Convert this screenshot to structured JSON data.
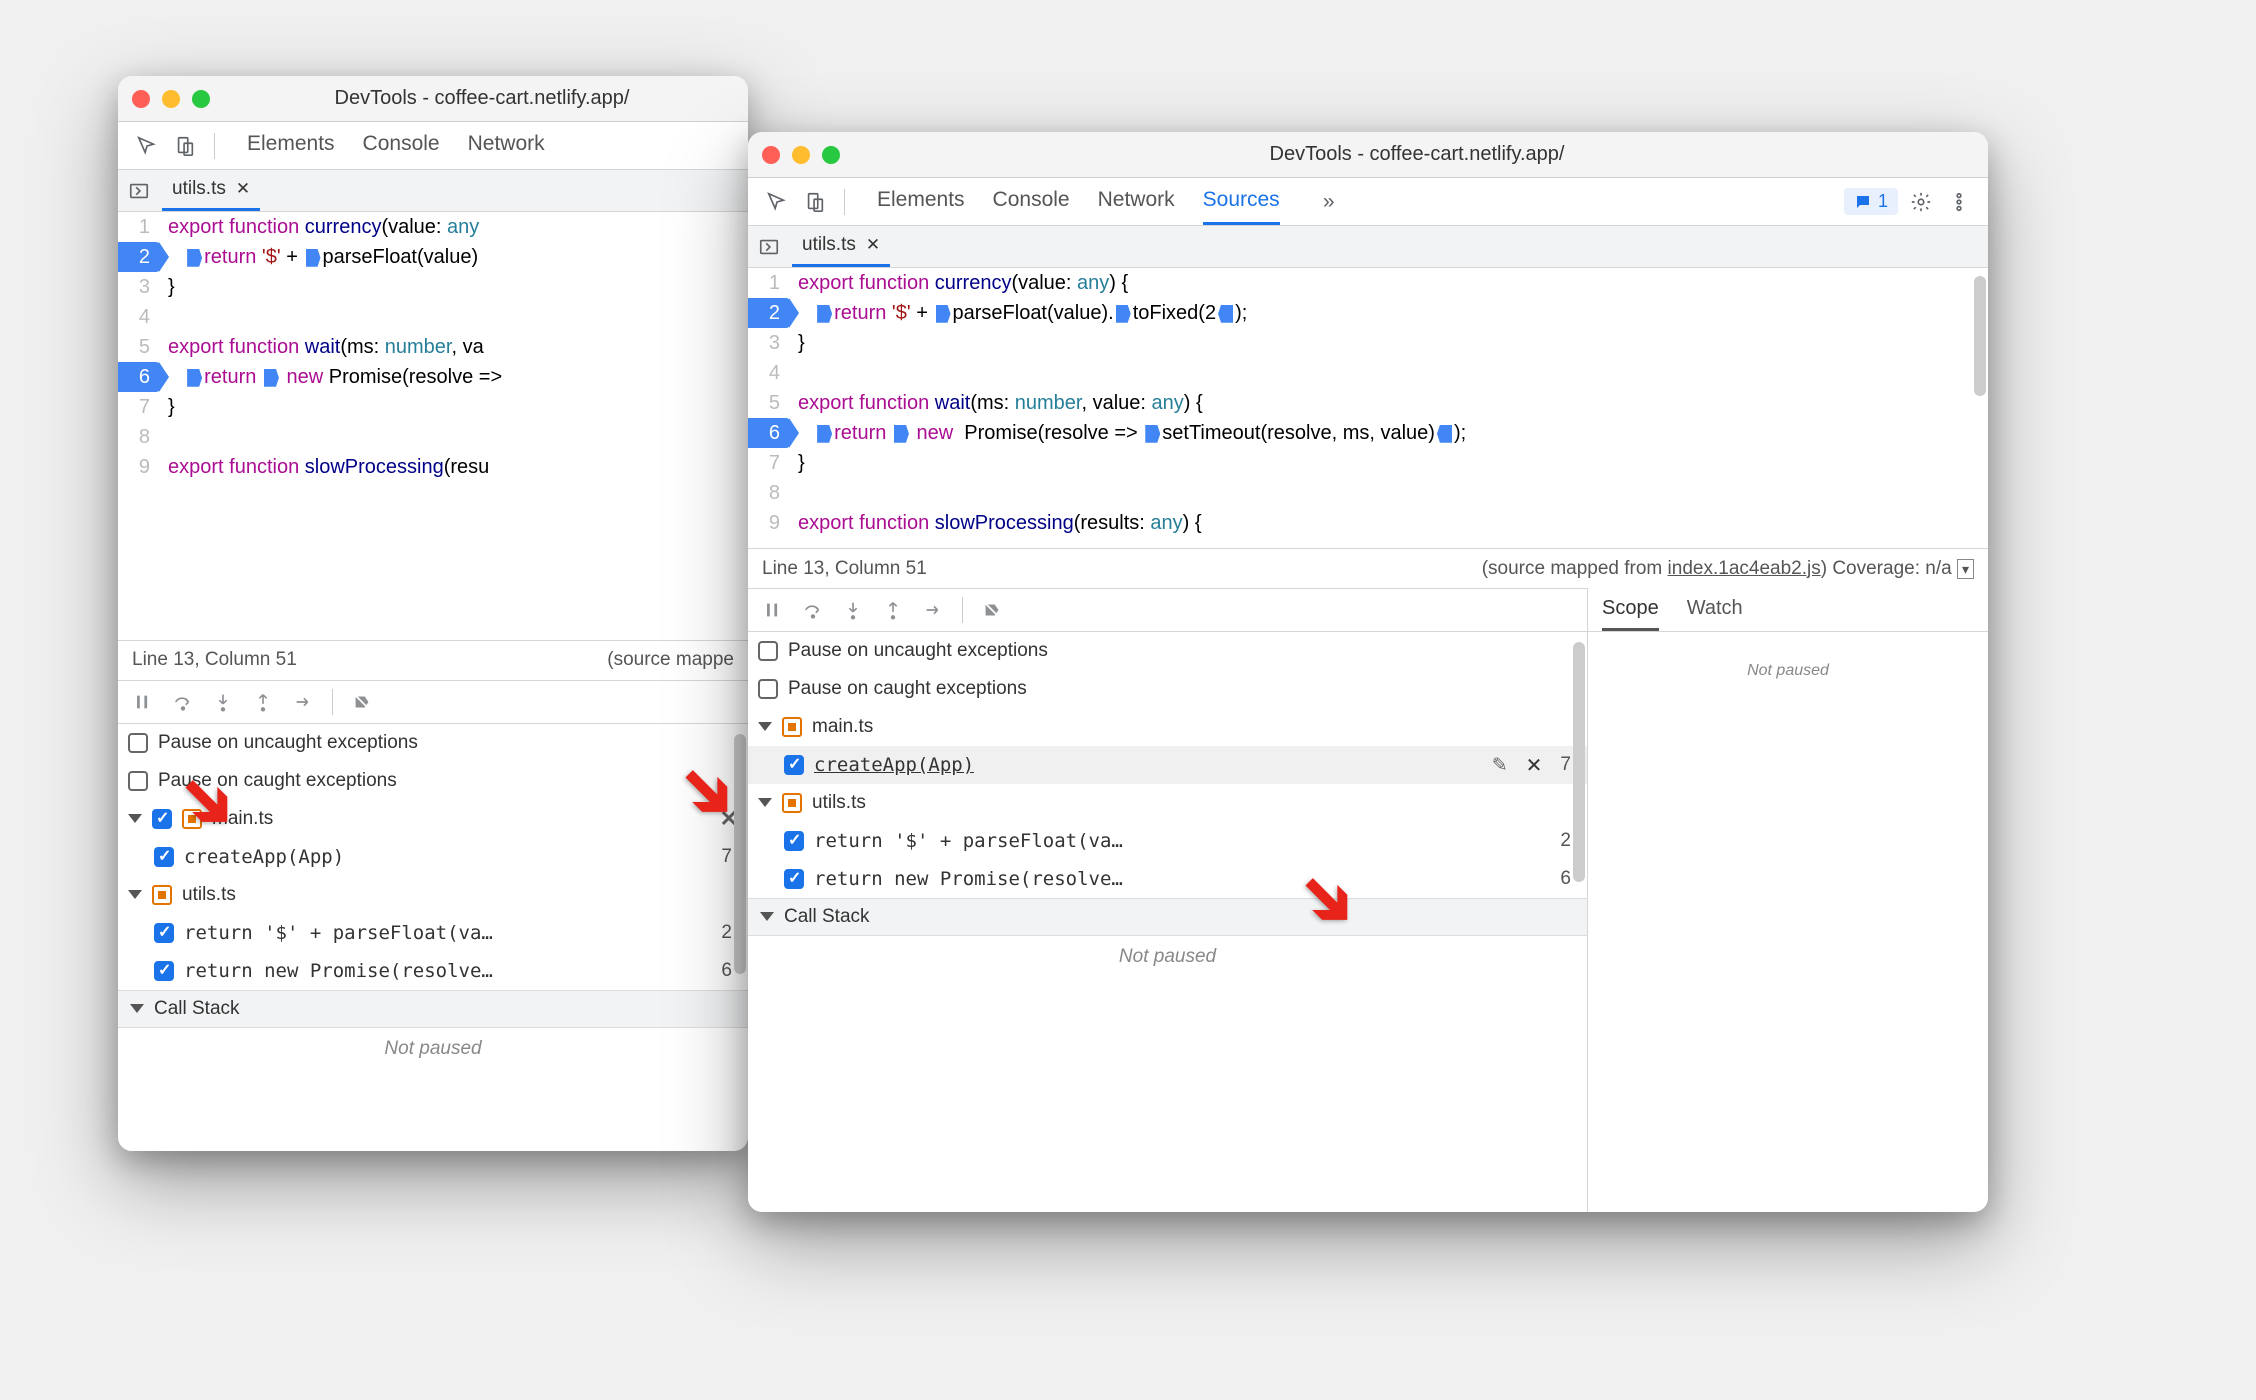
{
  "winA": {
    "title": "DevTools - coffee-cart.netlify.app/",
    "tabsPartial": [
      "Elements",
      "Console",
      "Network"
    ],
    "file": "utils.ts",
    "status_left": "Line 13, Column 51",
    "status_right": "(source mappe",
    "pause_uncaught": "Pause on uncaught exceptions",
    "pause_caught": "Pause on caught exceptions",
    "bp": {
      "main": {
        "file": "main.ts",
        "items": [
          {
            "label": "createApp(App)",
            "line": "7"
          }
        ]
      },
      "utils": {
        "file": "utils.ts",
        "items": [
          {
            "label": "return '$' + parseFloat(va…",
            "line": "2"
          },
          {
            "label": "return new Promise(resolve…",
            "line": "6"
          }
        ]
      }
    },
    "callstack": "Call Stack",
    "notpaused": "Not paused"
  },
  "winB": {
    "title": "DevTools - coffee-cart.netlify.app/",
    "tabs": [
      "Elements",
      "Console",
      "Network",
      "Sources"
    ],
    "activeTab": "Sources",
    "msgCount": "1",
    "file": "utils.ts",
    "status_left": "Line 13, Column 51",
    "status_mid_a": "(source mapped from ",
    "status_mid_link": "index.1ac4eab2.js",
    "status_mid_b": ") Coverage: n/a",
    "pause_uncaught": "Pause on uncaught exceptions",
    "pause_caught": "Pause on caught exceptions",
    "bp": {
      "main": {
        "file": "main.ts",
        "items": [
          {
            "label": "createApp(App)",
            "line": "7",
            "hover": true
          }
        ]
      },
      "utils": {
        "file": "utils.ts",
        "items": [
          {
            "label": "return '$' + parseFloat(va…",
            "line": "2"
          },
          {
            "label": "return new Promise(resolve…",
            "line": "6"
          }
        ]
      }
    },
    "callstack": "Call Stack",
    "notpaused": "Not paused",
    "scope": "Scope",
    "watch": "Watch"
  },
  "code": {
    "l1a": "export",
    "l1b": " function",
    "l1c": " currency",
    "l1d": "(value: ",
    "l1e": "any",
    "l1f": ") {",
    "l2a": "return",
    "l2b": " '$'",
    "l2c": " + ",
    "l2d": "parseFloat(value).",
    "l2e": "toFixed(",
    "l2f": "2",
    "l2g": ");",
    "l3": "}",
    "l5a": "export",
    "l5b": " function",
    "l5c": " wait",
    "l5d": "(ms: ",
    "l5e": "number",
    "l5f": ", value: ",
    "l5g": "any",
    "l5h": ") {",
    "l6a": "return",
    "l6b": " new",
    "l6c": " Promise(resolve => ",
    "l6d": "setTimeout(resolve, ms, value)",
    "l6e": ");",
    "l7": "}",
    "l9a": "export",
    "l9b": " function",
    "l9c": " slowProcessing",
    "l9d": "(results: ",
    "l9e": "any",
    "l9f": ") {",
    "l1A_cut": ") {",
    "l2A_cut": "parseFloat(value)",
    "l5A_cut": ", va",
    "l6A_cut": "Promise(resolve => "
  }
}
